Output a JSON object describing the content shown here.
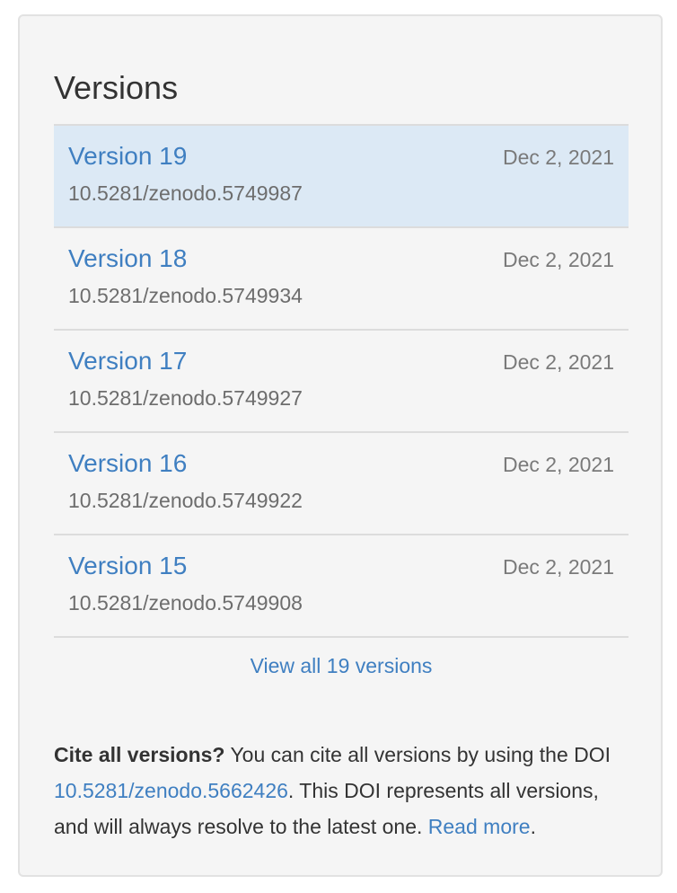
{
  "panel": {
    "title": "Versions"
  },
  "versions": [
    {
      "label": "Version 19",
      "doi": "10.5281/zenodo.5749987",
      "date": "Dec 2, 2021",
      "active": true
    },
    {
      "label": "Version 18",
      "doi": "10.5281/zenodo.5749934",
      "date": "Dec 2, 2021",
      "active": false
    },
    {
      "label": "Version 17",
      "doi": "10.5281/zenodo.5749927",
      "date": "Dec 2, 2021",
      "active": false
    },
    {
      "label": "Version 16",
      "doi": "10.5281/zenodo.5749922",
      "date": "Dec 2, 2021",
      "active": false
    },
    {
      "label": "Version 15",
      "doi": "10.5281/zenodo.5749908",
      "date": "Dec 2, 2021",
      "active": false
    }
  ],
  "view_all": "View all 19 versions",
  "cite": {
    "bold": "Cite all versions?",
    "text1": " You can cite all versions by using the DOI ",
    "doi_link": "10.5281/zenodo.5662426",
    "text2": ". This DOI represents all versions, and will always resolve to the latest one. ",
    "read_more": "Read more",
    "end": "."
  },
  "colors": {
    "link": "#3f7fc1",
    "active_row": "#dce9f5",
    "panel_bg": "#f5f5f5"
  }
}
